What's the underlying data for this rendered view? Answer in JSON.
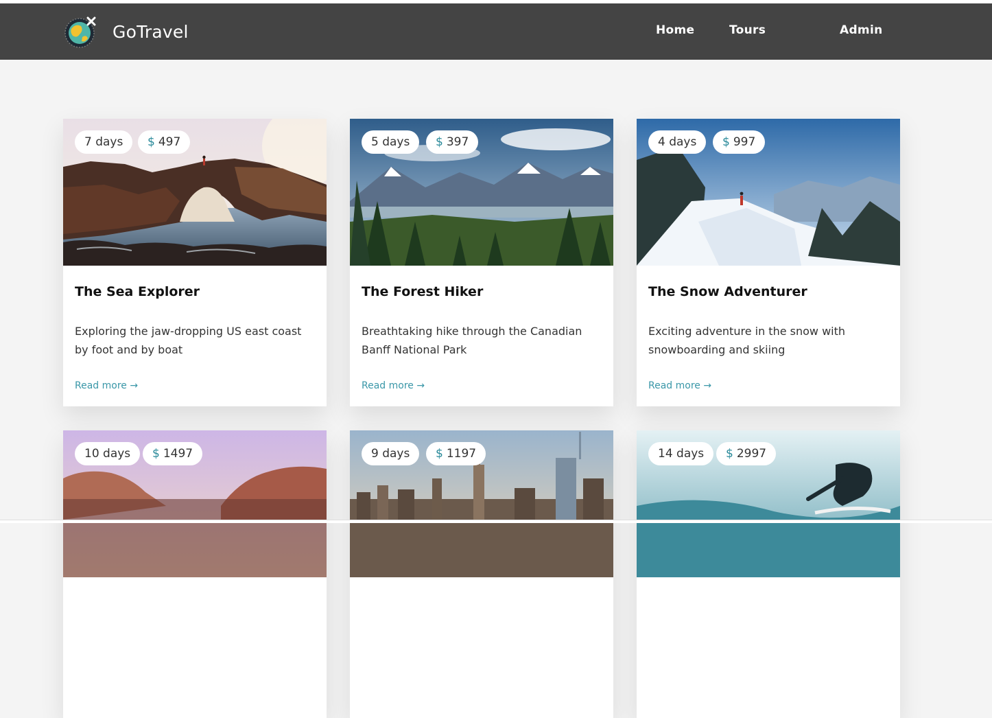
{
  "brand": {
    "name": "GoTravel",
    "logo_icon": "globe-plane-logo-icon"
  },
  "nav": {
    "home": "Home",
    "tours": "Tours",
    "admin": "Admin"
  },
  "colors": {
    "navbar": "#444444",
    "background": "#f4f4f4",
    "accent": "#3a97a8",
    "card": "#ffffff"
  },
  "currency_symbol": "$",
  "tours": [
    {
      "days": "7 days",
      "price": "497",
      "title": "The Sea Explorer",
      "description": "Exploring the jaw-dropping US east coast by foot and by boat",
      "read_more": "Read more →",
      "image": "sea-arch-image"
    },
    {
      "days": "5 days",
      "price": "397",
      "title": "The Forest Hiker",
      "description": "Breathtaking hike through the Canadian Banff National Park",
      "read_more": "Read more →",
      "image": "forest-mountains-image"
    },
    {
      "days": "4 days",
      "price": "997",
      "title": "The Snow Adventurer",
      "description": "Exciting adventure in the snow with snowboarding and skiing",
      "read_more": "Read more →",
      "image": "snow-ridge-image"
    },
    {
      "days": "10 days",
      "price": "1497",
      "title": "",
      "description": "",
      "read_more": "",
      "image": "canyon-image"
    },
    {
      "days": "9 days",
      "price": "1197",
      "title": "",
      "description": "",
      "read_more": "",
      "image": "city-skyline-image"
    },
    {
      "days": "14 days",
      "price": "2997",
      "title": "",
      "description": "",
      "read_more": "",
      "image": "surfer-image"
    }
  ]
}
